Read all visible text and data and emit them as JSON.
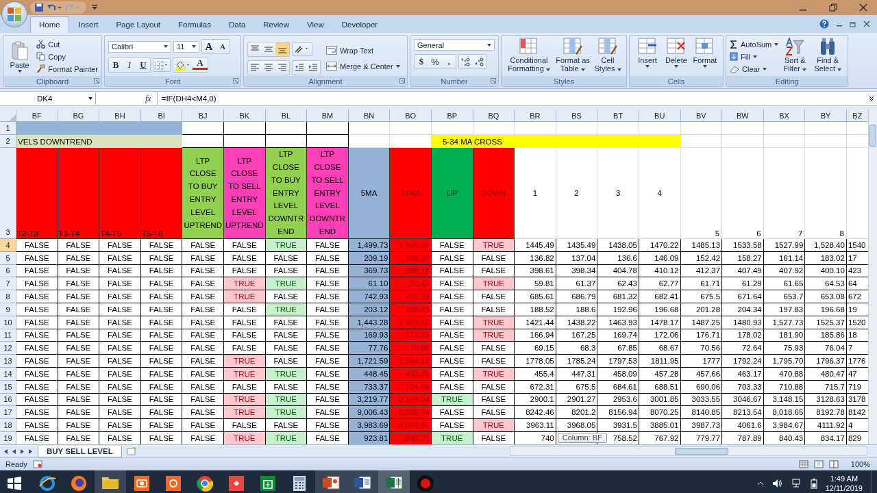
{
  "tabs": [
    {
      "label": "Home",
      "selected": true
    },
    {
      "label": "Insert",
      "selected": false
    },
    {
      "label": "Page Layout",
      "selected": false
    },
    {
      "label": "Formulas",
      "selected": false
    },
    {
      "label": "Data",
      "selected": false
    },
    {
      "label": "Review",
      "selected": false
    },
    {
      "label": "View",
      "selected": false
    },
    {
      "label": "Developer",
      "selected": false
    }
  ],
  "ribbon": {
    "clipboard": {
      "label": "Clipboard",
      "paste": "Paste",
      "cut": "Cut",
      "copy": "Copy",
      "format_painter": "Format Painter"
    },
    "font": {
      "label": "Font",
      "family": "Calibri",
      "size": "11",
      "grow": "A",
      "shrink": "A",
      "bold": "B",
      "italic": "I",
      "underline": "U",
      "font_color": "A"
    },
    "alignment": {
      "label": "Alignment",
      "wrap": "Wrap Text",
      "merge": "Merge & Center"
    },
    "number": {
      "label": "Number",
      "format": "General",
      "currency": "$",
      "percent": "%",
      "comma": ","
    },
    "styles": {
      "label": "Styles",
      "items": [
        "Conditional Formatting",
        "Format as Table",
        "Cell Styles"
      ]
    },
    "cells": {
      "label": "Cells",
      "items": [
        "Insert",
        "Delete",
        "Format"
      ]
    },
    "editing": {
      "label": "Editing",
      "autosum": "AutoSum",
      "fill": "Fill",
      "clear": "Clear",
      "sort": "Sort & Filter",
      "find": "Find & Select"
    }
  },
  "formula_bar": {
    "name_box": "DK4",
    "fx": "fx",
    "formula": "=IF(DH4<M4,0)"
  },
  "grid": {
    "columns": [
      {
        "label": "BF",
        "kind": "plain"
      },
      {
        "label": "BG",
        "kind": "plain"
      },
      {
        "label": "BH",
        "kind": "plain"
      },
      {
        "label": "BI",
        "kind": "plain"
      },
      {
        "label": "BJ",
        "kind": "plain"
      },
      {
        "label": "BK",
        "kind": "sell"
      },
      {
        "label": "BL",
        "kind": "buy"
      },
      {
        "label": "BM",
        "kind": "plain"
      },
      {
        "label": "BN",
        "kind": "ma5"
      },
      {
        "label": "BO",
        "kind": "ma34"
      },
      {
        "label": "BP",
        "kind": "buy"
      },
      {
        "label": "BQ",
        "kind": "sell"
      },
      {
        "label": "BR",
        "kind": "price"
      },
      {
        "label": "BS",
        "kind": "price"
      },
      {
        "label": "BT",
        "kind": "price"
      },
      {
        "label": "BU",
        "kind": "price"
      },
      {
        "label": "BV",
        "kind": "price"
      },
      {
        "label": "BW",
        "kind": "price"
      },
      {
        "label": "BX",
        "kind": "price"
      },
      {
        "label": "BY",
        "kind": "price"
      },
      {
        "label": "BZ",
        "kind": "price"
      }
    ],
    "row1": {
      "label": "1"
    },
    "row2": {
      "label": "2",
      "downtrend": "VELS DOWNTREND",
      "cross": "5-34 MA CROSS"
    },
    "row3": {
      "label": "3",
      "cells": [
        {
          "text": "T2-T3",
          "kind": "red-label"
        },
        {
          "text": "T3-T4",
          "kind": "red-label"
        },
        {
          "text": "T4-T5",
          "kind": "red-label"
        },
        {
          "text": "T5-T6",
          "kind": "red-label"
        },
        {
          "text": "LTP CLOSE TO BUY ENTRY LEVEL UPTREND",
          "kind": "buy"
        },
        {
          "text": "LTP CLOSE TO SELL ENTRY LEVEL UPTREND",
          "kind": "sell"
        },
        {
          "text": "LTP CLOSE TO BUY ENTRY LEVEL DOWNTREND",
          "kind": "buy"
        },
        {
          "text": "LTP CLOSE TO SELL ENTRY LEVEL DOWNTREND",
          "kind": "sell"
        },
        {
          "text": "5MA",
          "kind": "ma5"
        },
        {
          "text": "34MA",
          "kind": "ma34"
        },
        {
          "text": "UP",
          "kind": "up"
        },
        {
          "text": "DOWN",
          "kind": "down"
        },
        {
          "text": "1",
          "kind": "center"
        },
        {
          "text": "2",
          "kind": "center"
        },
        {
          "text": "3",
          "kind": "center"
        },
        {
          "text": "4",
          "kind": "center"
        },
        {
          "text": "5",
          "kind": "bottom"
        },
        {
          "text": "6",
          "kind": "bottom"
        },
        {
          "text": "7",
          "kind": "bottom"
        },
        {
          "text": "8",
          "kind": "bottom"
        },
        {
          "kind": "empty"
        }
      ]
    },
    "rows": [
      {
        "label": "4",
        "selected": true,
        "signals": [
          {
            "text": "FALSE",
            "highlighted": false
          },
          {
            "text": "FALSE",
            "highlighted": false
          },
          {
            "text": "FALSE",
            "highlighted": false
          },
          {
            "text": "FALSE",
            "highlighted": false
          },
          {
            "text": "FALSE",
            "highlighted": false
          },
          {
            "text": "FALSE",
            "highlighted": false
          },
          {
            "text": "TRUE",
            "highlighted": true
          },
          {
            "text": "FALSE",
            "highlighted": false
          }
        ],
        "ma5": "1,499.73",
        "ma34": "1,505.36",
        "up": {
          "text": "FALSE",
          "highlighted": false
        },
        "down": {
          "text": "TRUE",
          "highlighted": true
        },
        "prices": [
          "1445.49",
          "1435.49",
          "1438.05",
          "1470.22",
          "1485.13",
          "1533.58",
          "1527.99",
          "1,528.40",
          "1540"
        ]
      },
      {
        "label": "5",
        "selected": false,
        "signals": [
          {
            "text": "FALSE",
            "highlighted": false
          },
          {
            "text": "FALSE",
            "highlighted": false
          },
          {
            "text": "FALSE",
            "highlighted": false
          },
          {
            "text": "FALSE",
            "highlighted": false
          },
          {
            "text": "FALSE",
            "highlighted": false
          },
          {
            "text": "FALSE",
            "highlighted": false
          },
          {
            "text": "FALSE",
            "highlighted": false
          },
          {
            "text": "FALSE",
            "highlighted": false
          }
        ],
        "ma5": "209.19",
        "ma34": "189.20",
        "up": {
          "text": "FALSE",
          "highlighted": false
        },
        "down": {
          "text": "FALSE",
          "highlighted": false
        },
        "prices": [
          "136.82",
          "137.04",
          "136.6",
          "146.09",
          "152.42",
          "158.27",
          "161.14",
          "183.02",
          "17"
        ]
      },
      {
        "label": "6",
        "selected": false,
        "signals": [
          {
            "text": "FALSE",
            "highlighted": false
          },
          {
            "text": "FALSE",
            "highlighted": false
          },
          {
            "text": "FALSE",
            "highlighted": false
          },
          {
            "text": "FALSE",
            "highlighted": false
          },
          {
            "text": "FALSE",
            "highlighted": false
          },
          {
            "text": "FALSE",
            "highlighted": false
          },
          {
            "text": "FALSE",
            "highlighted": false
          },
          {
            "text": "FALSE",
            "highlighted": false
          }
        ],
        "ma5": "369.73",
        "ma34": "388.18",
        "up": {
          "text": "FALSE",
          "highlighted": false
        },
        "down": {
          "text": "FALSE",
          "highlighted": false
        },
        "prices": [
          "398.61",
          "398.34",
          "404.78",
          "410.12",
          "412.37",
          "407.49",
          "407.92",
          "400.10",
          "423"
        ]
      },
      {
        "label": "7",
        "selected": false,
        "signals": [
          {
            "text": "FALSE",
            "highlighted": false
          },
          {
            "text": "FALSE",
            "highlighted": false
          },
          {
            "text": "FALSE",
            "highlighted": false
          },
          {
            "text": "FALSE",
            "highlighted": false
          },
          {
            "text": "FALSE",
            "highlighted": false
          },
          {
            "text": "TRUE",
            "highlighted": true
          },
          {
            "text": "TRUE",
            "highlighted": true
          },
          {
            "text": "FALSE",
            "highlighted": false
          }
        ],
        "ma5": "61.10",
        "ma34": "63.46",
        "up": {
          "text": "FALSE",
          "highlighted": false
        },
        "down": {
          "text": "TRUE",
          "highlighted": true
        },
        "prices": [
          "59.81",
          "61.37",
          "62.43",
          "62.77",
          "61.71",
          "61.29",
          "61.65",
          "64.53",
          "64"
        ]
      },
      {
        "label": "8",
        "selected": false,
        "signals": [
          {
            "text": "FALSE",
            "highlighted": false
          },
          {
            "text": "FALSE",
            "highlighted": false
          },
          {
            "text": "FALSE",
            "highlighted": false
          },
          {
            "text": "FALSE",
            "highlighted": false
          },
          {
            "text": "FALSE",
            "highlighted": false
          },
          {
            "text": "TRUE",
            "highlighted": true
          },
          {
            "text": "FALSE",
            "highlighted": false
          },
          {
            "text": "FALSE",
            "highlighted": false
          }
        ],
        "ma5": "742.93",
        "ma34": "702.33",
        "up": {
          "text": "FALSE",
          "highlighted": false
        },
        "down": {
          "text": "FALSE",
          "highlighted": false
        },
        "prices": [
          "685.61",
          "686.79",
          "681.32",
          "682.41",
          "675.5",
          "671.64",
          "653.7",
          "653.08",
          "672"
        ]
      },
      {
        "label": "9",
        "selected": false,
        "signals": [
          {
            "text": "FALSE",
            "highlighted": false
          },
          {
            "text": "FALSE",
            "highlighted": false
          },
          {
            "text": "FALSE",
            "highlighted": false
          },
          {
            "text": "FALSE",
            "highlighted": false
          },
          {
            "text": "FALSE",
            "highlighted": false
          },
          {
            "text": "FALSE",
            "highlighted": false
          },
          {
            "text": "TRUE",
            "highlighted": true
          },
          {
            "text": "FALSE",
            "highlighted": false
          }
        ],
        "ma5": "203.12",
        "ma34": "199.81",
        "up": {
          "text": "FALSE",
          "highlighted": false
        },
        "down": {
          "text": "FALSE",
          "highlighted": false
        },
        "prices": [
          "188.52",
          "188.6",
          "192.96",
          "196.68",
          "201.28",
          "204.34",
          "197.83",
          "196.68",
          "19"
        ]
      },
      {
        "label": "10",
        "selected": false,
        "signals": [
          {
            "text": "FALSE",
            "highlighted": false
          },
          {
            "text": "FALSE",
            "highlighted": false
          },
          {
            "text": "FALSE",
            "highlighted": false
          },
          {
            "text": "FALSE",
            "highlighted": false
          },
          {
            "text": "FALSE",
            "highlighted": false
          },
          {
            "text": "FALSE",
            "highlighted": false
          },
          {
            "text": "FALSE",
            "highlighted": false
          },
          {
            "text": "FALSE",
            "highlighted": false
          }
        ],
        "ma5": "1,443.28",
        "ma34": "1,459.62",
        "up": {
          "text": "FALSE",
          "highlighted": false
        },
        "down": {
          "text": "TRUE",
          "highlighted": true
        },
        "prices": [
          "1421.44",
          "1438.22",
          "1463.93",
          "1478.17",
          "1487.25",
          "1480.93",
          "1,527.73",
          "1525.37",
          "1520"
        ]
      },
      {
        "label": "11",
        "selected": false,
        "signals": [
          {
            "text": "FALSE",
            "highlighted": false
          },
          {
            "text": "FALSE",
            "highlighted": false
          },
          {
            "text": "FALSE",
            "highlighted": false
          },
          {
            "text": "FALSE",
            "highlighted": false
          },
          {
            "text": "FALSE",
            "highlighted": false
          },
          {
            "text": "FALSE",
            "highlighted": false
          },
          {
            "text": "FALSE",
            "highlighted": false
          },
          {
            "text": "FALSE",
            "highlighted": false
          }
        ],
        "ma5": "169.93",
        "ma34": "174.15",
        "up": {
          "text": "FALSE",
          "highlighted": false
        },
        "down": {
          "text": "TRUE",
          "highlighted": true
        },
        "prices": [
          "166.94",
          "167.25",
          "169.74",
          "172.06",
          "176.71",
          "178.02",
          "181.90",
          "185.86",
          "18"
        ]
      },
      {
        "label": "12",
        "selected": false,
        "signals": [
          {
            "text": "FALSE",
            "highlighted": false
          },
          {
            "text": "FALSE",
            "highlighted": false
          },
          {
            "text": "FALSE",
            "highlighted": false
          },
          {
            "text": "FALSE",
            "highlighted": false
          },
          {
            "text": "FALSE",
            "highlighted": false
          },
          {
            "text": "FALSE",
            "highlighted": false
          },
          {
            "text": "FALSE",
            "highlighted": false
          },
          {
            "text": "FALSE",
            "highlighted": false
          }
        ],
        "ma5": "77.76",
        "ma34": "76.86",
        "up": {
          "text": "FALSE",
          "highlighted": false
        },
        "down": {
          "text": "FALSE",
          "highlighted": false
        },
        "prices": [
          "69.15",
          "68.3",
          "67.85",
          "68.67",
          "70.56",
          "72.64",
          "75.93",
          "76.04",
          "7"
        ]
      },
      {
        "label": "13",
        "selected": false,
        "signals": [
          {
            "text": "FALSE",
            "highlighted": false
          },
          {
            "text": "FALSE",
            "highlighted": false
          },
          {
            "text": "FALSE",
            "highlighted": false
          },
          {
            "text": "FALSE",
            "highlighted": false
          },
          {
            "text": "FALSE",
            "highlighted": false
          },
          {
            "text": "TRUE",
            "highlighted": true
          },
          {
            "text": "FALSE",
            "highlighted": false
          },
          {
            "text": "FALSE",
            "highlighted": false
          }
        ],
        "ma5": "1,721.59",
        "ma34": "1,764.12",
        "up": {
          "text": "FALSE",
          "highlighted": false
        },
        "down": {
          "text": "FALSE",
          "highlighted": false
        },
        "prices": [
          "1778.05",
          "1785.24",
          "1797.53",
          "1811.95",
          "1777",
          "1792.24",
          "1,795.70",
          "1796.37",
          "1776"
        ]
      },
      {
        "label": "14",
        "selected": false,
        "signals": [
          {
            "text": "FALSE",
            "highlighted": false
          },
          {
            "text": "FALSE",
            "highlighted": false
          },
          {
            "text": "FALSE",
            "highlighted": false
          },
          {
            "text": "FALSE",
            "highlighted": false
          },
          {
            "text": "FALSE",
            "highlighted": false
          },
          {
            "text": "TRUE",
            "highlighted": true
          },
          {
            "text": "TRUE",
            "highlighted": true
          },
          {
            "text": "FALSE",
            "highlighted": false
          }
        ],
        "ma5": "448.45",
        "ma34": "453.76",
        "up": {
          "text": "FALSE",
          "highlighted": false
        },
        "down": {
          "text": "TRUE",
          "highlighted": true
        },
        "prices": [
          "455.4",
          "447.31",
          "458.09",
          "457.28",
          "457.66",
          "463.17",
          "470.88",
          "480.47",
          "47"
        ]
      },
      {
        "label": "15",
        "selected": false,
        "signals": [
          {
            "text": "FALSE",
            "highlighted": false
          },
          {
            "text": "FALSE",
            "highlighted": false
          },
          {
            "text": "FALSE",
            "highlighted": false
          },
          {
            "text": "FALSE",
            "highlighted": false
          },
          {
            "text": "FALSE",
            "highlighted": false
          },
          {
            "text": "FALSE",
            "highlighted": false
          },
          {
            "text": "FALSE",
            "highlighted": false
          },
          {
            "text": "FALSE",
            "highlighted": false
          }
        ],
        "ma5": "733.37",
        "ma34": "724.56",
        "up": {
          "text": "FALSE",
          "highlighted": false
        },
        "down": {
          "text": "FALSE",
          "highlighted": false
        },
        "prices": [
          "672.31",
          "675.5",
          "684.61",
          "688.51",
          "690.06",
          "703.33",
          "710.88",
          "715.7",
          "719"
        ]
      },
      {
        "label": "16",
        "selected": false,
        "signals": [
          {
            "text": "FALSE",
            "highlighted": false
          },
          {
            "text": "FALSE",
            "highlighted": false
          },
          {
            "text": "FALSE",
            "highlighted": false
          },
          {
            "text": "FALSE",
            "highlighted": false
          },
          {
            "text": "FALSE",
            "highlighted": false
          },
          {
            "text": "TRUE",
            "highlighted": true
          },
          {
            "text": "TRUE",
            "highlighted": true
          },
          {
            "text": "FALSE",
            "highlighted": false
          }
        ],
        "ma5": "3,219.77",
        "ma34": "3,159.04",
        "up": {
          "text": "TRUE",
          "highlighted": true
        },
        "down": {
          "text": "FALSE",
          "highlighted": false
        },
        "prices": [
          "2900.1",
          "2901.27",
          "2953.6",
          "3001.85",
          "3033.55",
          "3046.67",
          "3,148.15",
          "3128.63",
          "3178"
        ]
      },
      {
        "label": "17",
        "selected": false,
        "signals": [
          {
            "text": "FALSE",
            "highlighted": false
          },
          {
            "text": "FALSE",
            "highlighted": false
          },
          {
            "text": "FALSE",
            "highlighted": false
          },
          {
            "text": "FALSE",
            "highlighted": false
          },
          {
            "text": "FALSE",
            "highlighted": false
          },
          {
            "text": "TRUE",
            "highlighted": true
          },
          {
            "text": "TRUE",
            "highlighted": true
          },
          {
            "text": "FALSE",
            "highlighted": false
          }
        ],
        "ma5": "9,006.43",
        "ma34": "8,635.24",
        "up": {
          "text": "FALSE",
          "highlighted": false
        },
        "down": {
          "text": "FALSE",
          "highlighted": false
        },
        "prices": [
          "8242.46",
          "8201.2",
          "8156.94",
          "8070.25",
          "8140.85",
          "8213.54",
          "8,018.65",
          "8192.78",
          "8142"
        ]
      },
      {
        "label": "18",
        "selected": false,
        "signals": [
          {
            "text": "FALSE",
            "highlighted": false
          },
          {
            "text": "FALSE",
            "highlighted": false
          },
          {
            "text": "FALSE",
            "highlighted": false
          },
          {
            "text": "FALSE",
            "highlighted": false
          },
          {
            "text": "FALSE",
            "highlighted": false
          },
          {
            "text": "FALSE",
            "highlighted": false
          },
          {
            "text": "FALSE",
            "highlighted": false
          },
          {
            "text": "FALSE",
            "highlighted": false
          }
        ],
        "ma5": "3,983.69",
        "ma34": "4,063.83",
        "up": {
          "text": "FALSE",
          "highlighted": false
        },
        "down": {
          "text": "TRUE",
          "highlighted": true
        },
        "prices": [
          "3963.11",
          "3968.05",
          "3931.5",
          "3885.01",
          "3987.73",
          "4061.6",
          "3,984.67",
          "4111.92",
          "4"
        ]
      },
      {
        "label": "19",
        "selected": false,
        "signals": [
          {
            "text": "FALSE",
            "highlighted": false
          },
          {
            "text": "FALSE",
            "highlighted": false
          },
          {
            "text": "FALSE",
            "highlighted": false
          },
          {
            "text": "FALSE",
            "highlighted": false
          },
          {
            "text": "FALSE",
            "highlighted": false
          },
          {
            "text": "TRUE",
            "highlighted": true
          },
          {
            "text": "TRUE",
            "highlighted": true
          },
          {
            "text": "FALSE",
            "highlighted": false
          }
        ],
        "ma5": "923.81",
        "ma34": "849.70",
        "up": {
          "text": "TRUE",
          "highlighted": true
        },
        "down": {
          "text": "FALSE",
          "highlighted": false
        },
        "prices": [
          "740",
          "758.52",
          "767.92",
          "779.77",
          "787.89",
          "840.43",
          "834.17",
          "829"
        ],
        "tooltip": "Column: BF"
      }
    ]
  },
  "sheets": [
    {
      "label": "BUY SELL LEVEL",
      "selected": true
    }
  ],
  "status_bar": {
    "status": "Ready",
    "zoom": "100%"
  },
  "taskbar": {
    "time": "1:49 AM",
    "date": "12/11/2019"
  }
}
